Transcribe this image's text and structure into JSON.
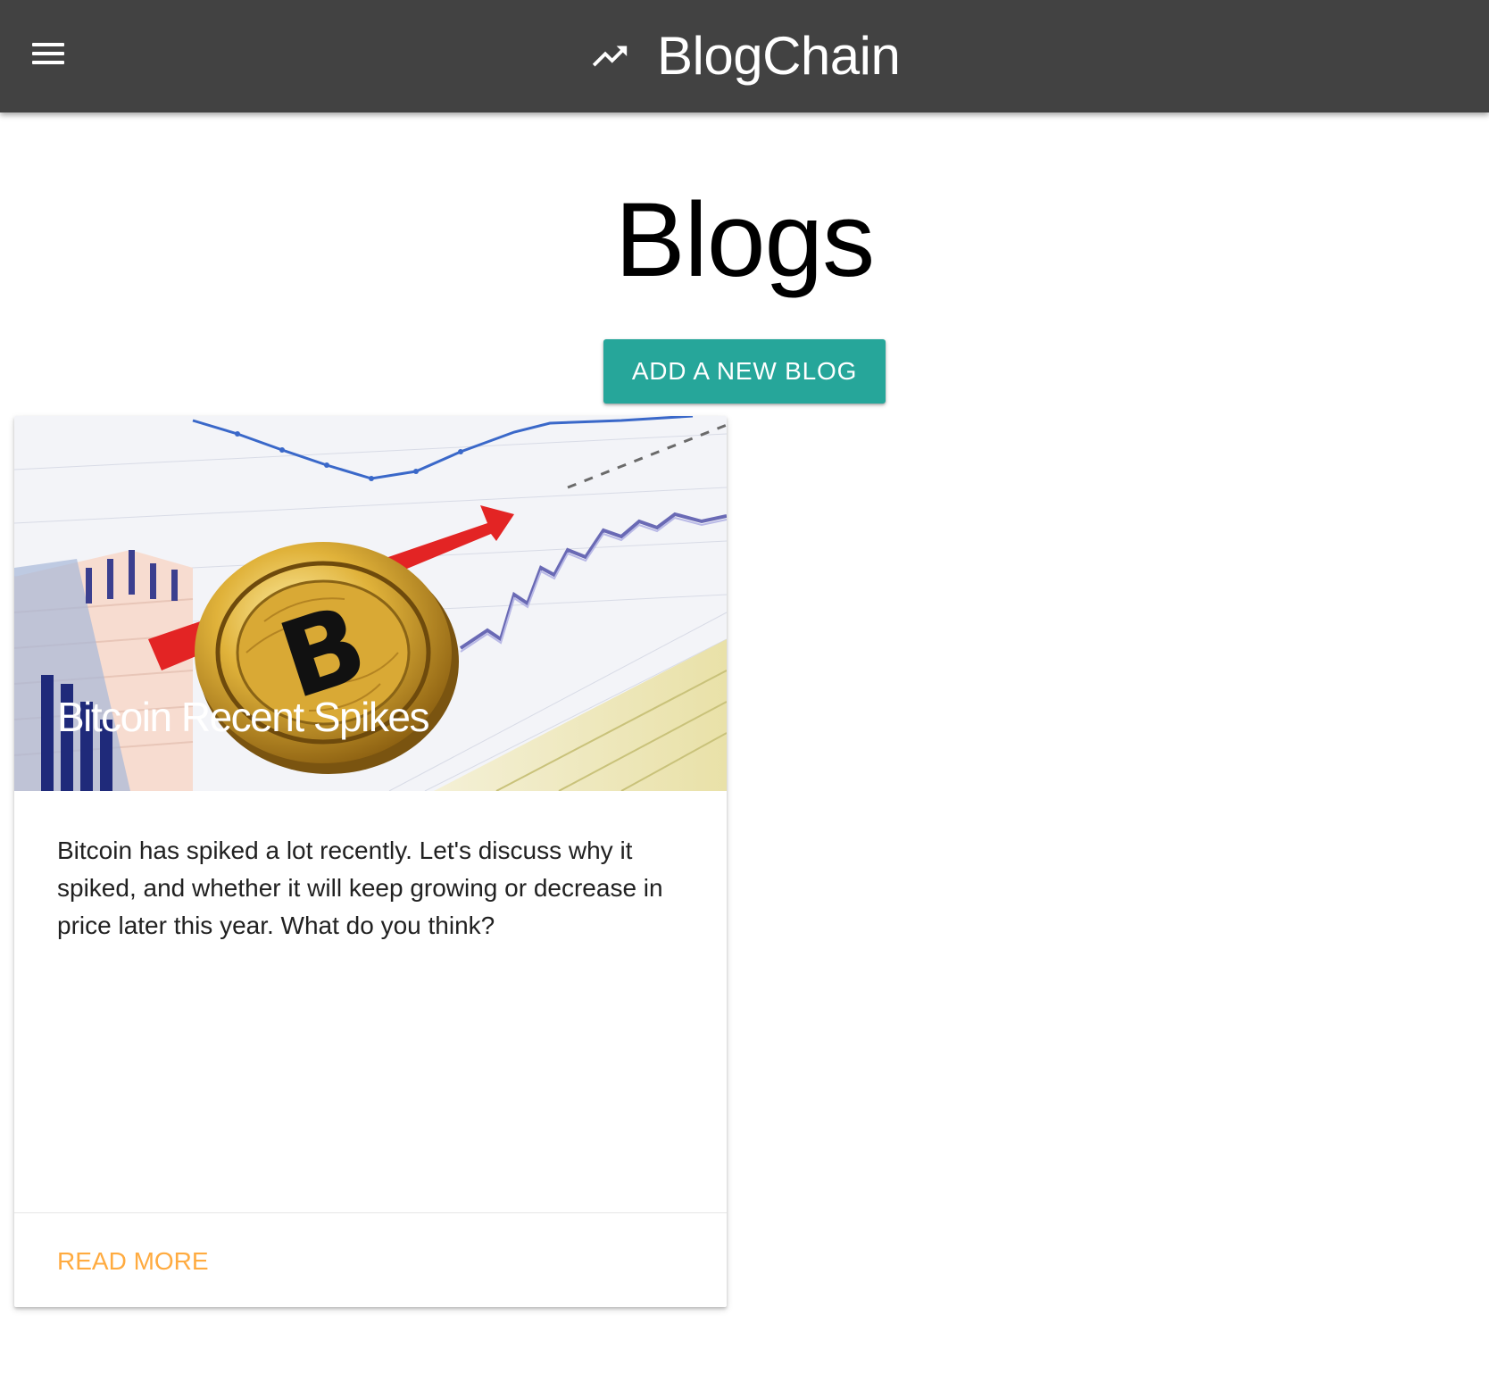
{
  "navbar": {
    "menu_icon": "hamburger-menu-icon",
    "brand_icon": "trending-up-icon",
    "brand_title": "BlogChain",
    "background_color": "#424242"
  },
  "page": {
    "title": "Blogs"
  },
  "actions": {
    "add_blog_label": "ADD A NEW BLOG",
    "button_color": "#26a69a"
  },
  "blogs": [
    {
      "title": "Bitcoin Recent Spikes",
      "image": "bitcoin-coin-on-financial-charts",
      "description": "Bitcoin has spiked a lot recently. Let's discuss why it spiked, and whether it will keep growing or decrease in price later this year. What do you think?",
      "read_more_label": "READ MORE",
      "link_color": "#ffab40"
    }
  ]
}
